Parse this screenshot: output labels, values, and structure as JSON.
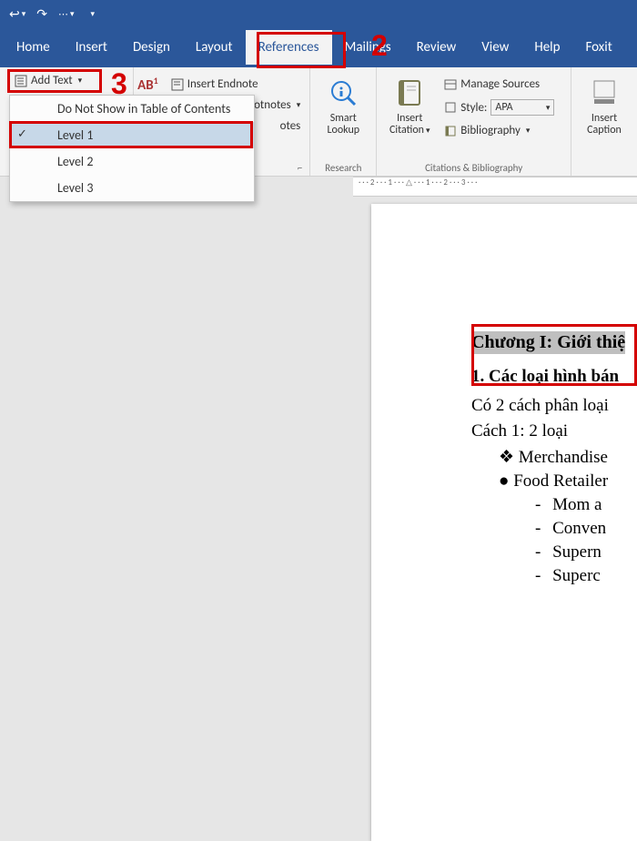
{
  "qat": {
    "undo": "↩",
    "redo": "↷"
  },
  "tabs": {
    "home": "Home",
    "insert": "Insert",
    "design": "Design",
    "layout": "Layout",
    "references": "References",
    "mailings": "Mailings",
    "review": "Review",
    "view": "View",
    "help": "Help",
    "foxit": "Foxit"
  },
  "ribbon": {
    "add_text": "Add Text",
    "ab_super": "AB",
    "insert_endnote": "Insert Endnote",
    "otnotes": "otnotes",
    "smart_lookup": "Smart\nLookup",
    "research_lbl": "Research",
    "insert_citation": "Insert\nCitation",
    "manage_sources": "Manage Sources",
    "style_lbl": "Style:",
    "style_val": "APA",
    "bibliography": "Bibliography",
    "citations_lbl": "Citations & Bibliography",
    "insert_caption": "Insert\nCaption",
    "otes": "otes"
  },
  "dropdown": {
    "dont_show": "Do Not Show in Table of Contents",
    "level1": "Level 1",
    "level2": "Level 2",
    "level3": "Level 3"
  },
  "annotations": {
    "num2": "2",
    "num3": "3"
  },
  "ruler": "· · · 2 · · · 1 · · · △ · · · 1 · · · 2 · · · 3 · · ·",
  "doc": {
    "title": "Chương I: Giới thiệ",
    "h1": "1. Các loại hình bán",
    "p1": "Có 2 cách phân loại",
    "p2": "Cách 1: 2 loại",
    "b1": "Merchandise",
    "b2": "Food Retailer",
    "s1": "Mom a",
    "s2": "Conven",
    "s3": "Supern",
    "s4": "Superc"
  }
}
